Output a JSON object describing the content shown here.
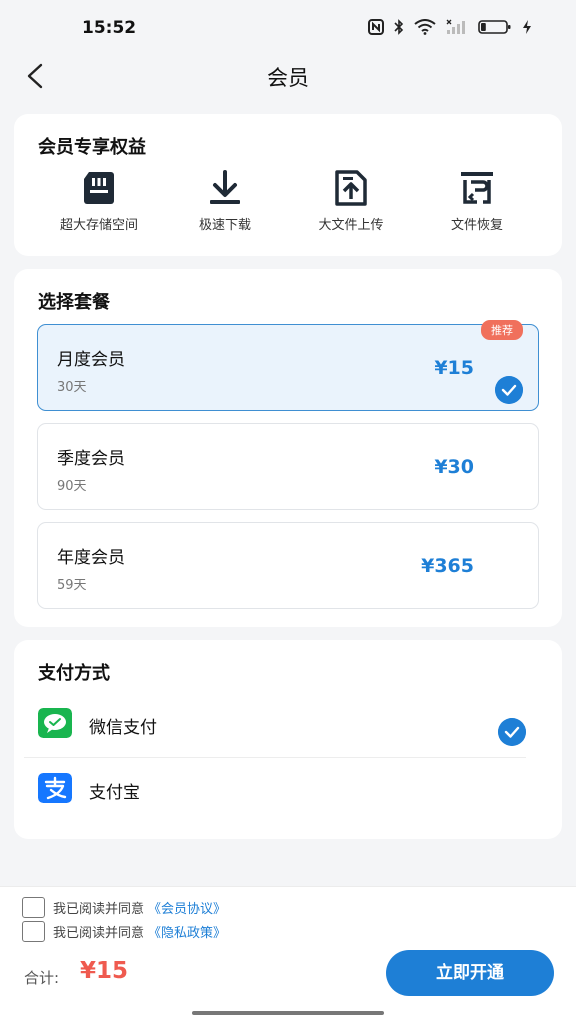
{
  "status_bar": {
    "time": "15:52",
    "icons": [
      "nfc-icon",
      "bluetooth-icon",
      "wifi-icon",
      "signal-icon",
      "battery-icon",
      "charging-icon"
    ],
    "battery_level": 0.2
  },
  "nav": {
    "back_icon": "chevron-left-icon",
    "title": "会员"
  },
  "benefits": {
    "title": "会员专享权益",
    "items": [
      {
        "icon": "sd-card-icon",
        "label": "超大存储空间"
      },
      {
        "icon": "download-icon",
        "label": "极速下载"
      },
      {
        "icon": "file-upload-icon",
        "label": "大文件上传"
      },
      {
        "icon": "file-restore-icon",
        "label": "文件恢复"
      }
    ]
  },
  "plans": {
    "title": "选择套餐",
    "items": [
      {
        "name": "月度会员",
        "days": "30天",
        "price": "¥15",
        "badge": "推荐",
        "selected": true
      },
      {
        "name": "季度会员",
        "days": "90天",
        "price": "¥30",
        "selected": false
      },
      {
        "name": "年度会员",
        "days": "59天",
        "price": "¥365",
        "selected": false
      }
    ]
  },
  "payment": {
    "title": "支付方式",
    "methods": [
      {
        "icon": "wechat-pay-icon",
        "label": "微信支付",
        "selected": true
      },
      {
        "icon": "alipay-icon",
        "label": "支付宝",
        "selected": false
      }
    ]
  },
  "agreements": [
    {
      "text": "我已阅读并同意",
      "link": "《会员协议》",
      "checked": false
    },
    {
      "text": "我已阅读并同意",
      "link": "《隐私政策》",
      "checked": false
    }
  ],
  "total": {
    "label": "合计:",
    "value": "¥15"
  },
  "submit_label": "立即开通",
  "colors": {
    "accent": "#1e7fd6",
    "price_red": "#ef5a4f",
    "badge": "#f0705c",
    "wechat_green": "#19b54f",
    "alipay_blue": "#1677ff"
  }
}
